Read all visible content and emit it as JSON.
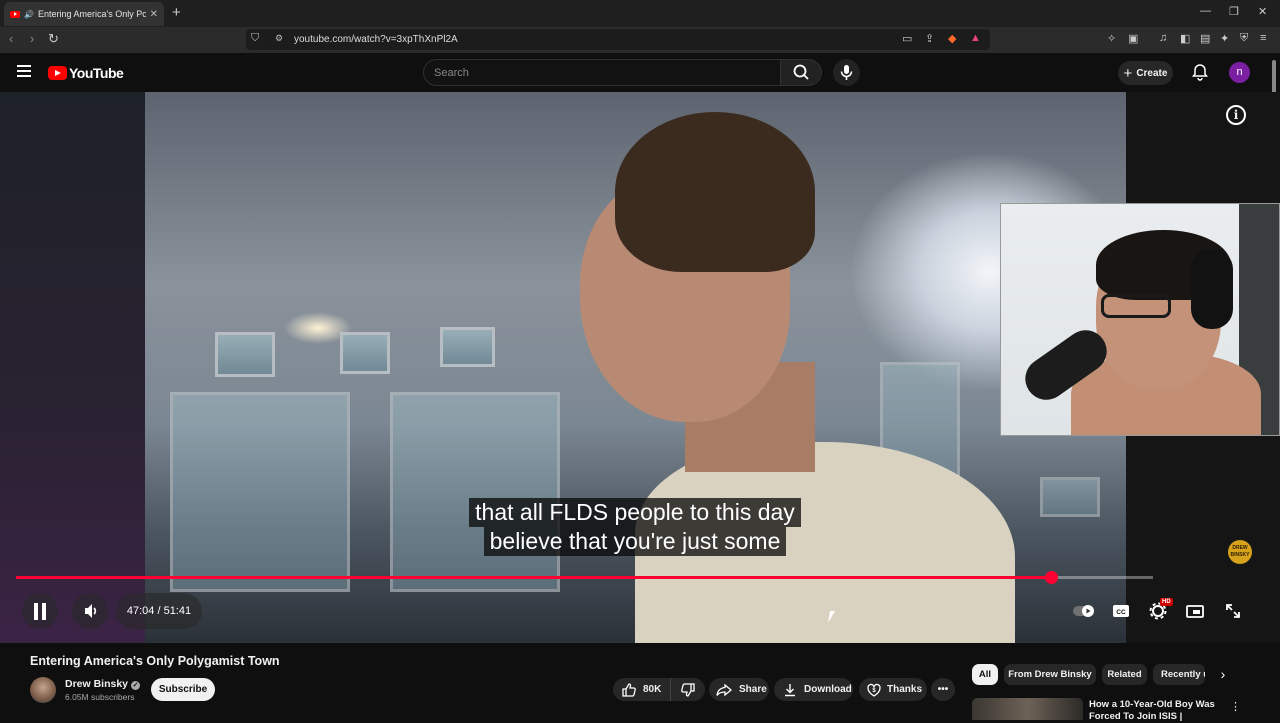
{
  "browser": {
    "tab_title": "Entering America's Only Polyg",
    "tab_close": "✕",
    "new_tab": "+",
    "url": "youtube.com/watch?v=3xpThXnPl2A",
    "window_min": "—",
    "window_restore": "❐",
    "window_close": "✕"
  },
  "youtube_header": {
    "logo_text": "YouTube",
    "search_placeholder": "Search",
    "create_label": "Create",
    "avatar_letter": "n"
  },
  "player": {
    "caption_line1": "that all FLDS people to this day",
    "caption_line2": "believe that you're just some",
    "time_display": "47:04 / 51:41",
    "progress_fraction": 0.9106,
    "hd_badge": "HD",
    "info_symbol": "i",
    "watermark_text": "DREW BINSKY"
  },
  "video": {
    "title": "Entering America's Only Polygamist Town",
    "channel_name": "Drew Binsky",
    "subscriber_count": "6.05M subscribers",
    "subscribe_label": "Subscribe",
    "like_count": "80K",
    "share_label": "Share",
    "download_label": "Download",
    "thanks_label": "Thanks"
  },
  "related_chips": {
    "all": "All",
    "from_channel": "From Drew Binsky",
    "related": "Related",
    "recently": "Recently u"
  },
  "recommendation": {
    "title": "How a 10-Year-Old Boy Was Forced To Join ISIS |"
  },
  "colors": {
    "brand_red": "#ff0000",
    "progress_red": "#ff0033",
    "background": "#0f0f0f",
    "chip_bg": "#272727"
  }
}
